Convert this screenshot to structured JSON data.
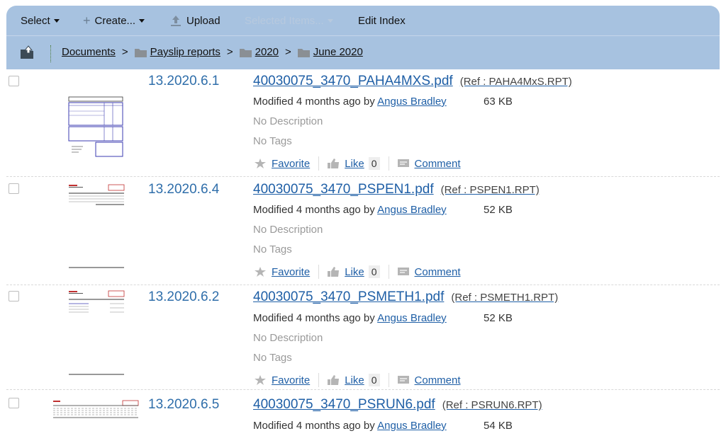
{
  "toolbar": {
    "select_label": "Select",
    "create_label": "Create...",
    "upload_label": "Upload",
    "selected_items_label": "Selected Items...",
    "edit_index_label": "Edit Index"
  },
  "breadcrumb": [
    "Documents",
    "Payslip reports",
    "2020",
    "June 2020"
  ],
  "breadcrumb_separator": ">",
  "labels": {
    "modified_prefix": "Modified 4 months ago by",
    "no_description": "No Description",
    "no_tags": "No Tags",
    "favorite": "Favorite",
    "like": "Like",
    "comment": "Comment"
  },
  "items": [
    {
      "number": "13.2020.6.1",
      "filename": "40030075_3470_PAHA4MXS.pdf",
      "ref": "(Ref : PAHA4MxS.RPT)",
      "author": "Angus Bradley",
      "size": "63 KB",
      "likes": "0"
    },
    {
      "number": "13.2020.6.4",
      "filename": "40030075_3470_PSPEN1.pdf",
      "ref": "(Ref : PSPEN1.RPT)",
      "author": "Angus Bradley",
      "size": "52 KB",
      "likes": "0"
    },
    {
      "number": "13.2020.6.2",
      "filename": "40030075_3470_PSMETH1.pdf",
      "ref": "(Ref : PSMETH1.RPT)",
      "author": "Angus Bradley",
      "size": "52 KB",
      "likes": "0"
    },
    {
      "number": "13.2020.6.5",
      "filename": "40030075_3470_PSRUN6.pdf",
      "ref": "(Ref : PSRUN6.RPT)",
      "author": "Angus Bradley",
      "size": "54 KB"
    }
  ]
}
